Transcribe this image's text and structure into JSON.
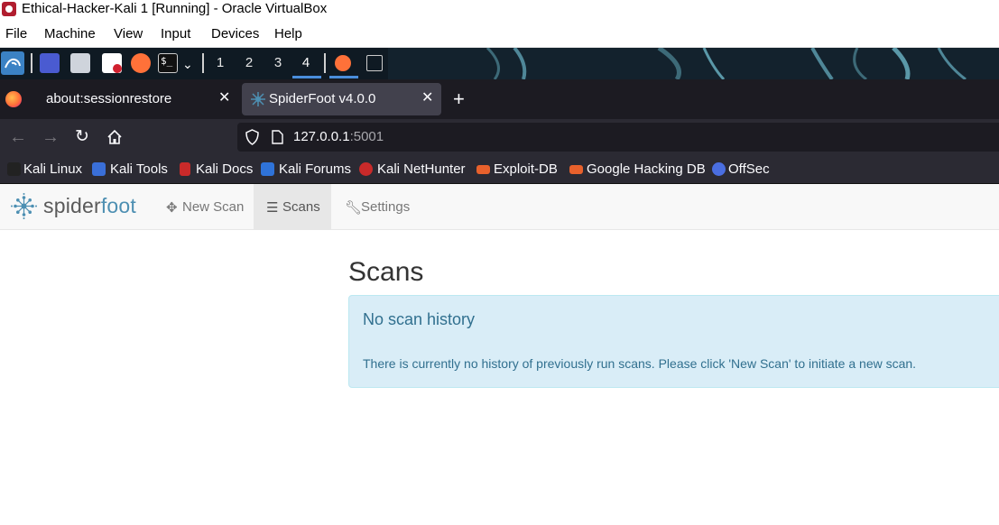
{
  "window": {
    "title": "Ethical-Hacker-Kali 1 [Running] - Oracle VirtualBox",
    "menu": [
      "File",
      "Machine",
      "View",
      "Input",
      "Devices",
      "Help"
    ]
  },
  "panel": {
    "workspaces": [
      "1",
      "2",
      "3",
      "4"
    ],
    "active_workspace": "4"
  },
  "browser": {
    "tabs": [
      {
        "label": "about:sessionrestore",
        "active": false
      },
      {
        "label": "SpiderFoot v4.0.0",
        "active": true
      }
    ],
    "url_host": "127.0.0.1",
    "url_port": ":5001",
    "bookmarks": [
      "Kali Linux",
      "Kali Tools",
      "Kali Docs",
      "Kali Forums",
      "Kali NetHunter",
      "Exploit-DB",
      "Google Hacking DB",
      "OffSec"
    ]
  },
  "spiderfoot": {
    "brand_left": "spider",
    "brand_right": "foot",
    "nav": {
      "new_scan": "New Scan",
      "scans": "Scans",
      "settings": "Settings",
      "active": "Scans"
    },
    "page_title": "Scans",
    "alert": {
      "title": "No scan history",
      "body": "There is currently no history of previously run scans. Please click 'New Scan' to initiate a new scan."
    }
  },
  "colors": {
    "brand_blue": "#4d8fb2",
    "alert_bg": "#d9edf7",
    "alert_text": "#31708f",
    "browser_dark": "#1c1b22"
  }
}
